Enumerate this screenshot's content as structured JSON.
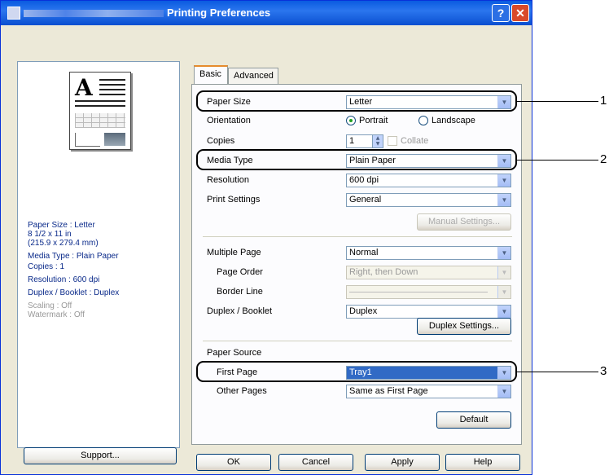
{
  "window": {
    "title": "Printing Preferences"
  },
  "tabs": [
    "Basic",
    "Advanced"
  ],
  "summary": {
    "paper_size": "Paper Size : Letter",
    "dimensions_in": "8 1/2 x 11 in",
    "dimensions_mm": "(215.9 x 279.4 mm)",
    "media_type": "Media Type : Plain Paper",
    "copies": "Copies : 1",
    "resolution": "Resolution : 600 dpi",
    "duplex": "Duplex / Booklet : Duplex",
    "scaling": "Scaling : Off",
    "watermark": "Watermark : Off"
  },
  "form": {
    "paper_size_label": "Paper Size",
    "paper_size_value": "Letter",
    "orientation_label": "Orientation",
    "portrait": "Portrait",
    "landscape": "Landscape",
    "copies_label": "Copies",
    "copies_value": "1",
    "collate": "Collate",
    "media_type_label": "Media Type",
    "media_type_value": "Plain Paper",
    "resolution_label": "Resolution",
    "resolution_value": "600 dpi",
    "print_settings_label": "Print Settings",
    "print_settings_value": "General",
    "manual_settings": "Manual Settings...",
    "multiple_page_label": "Multiple Page",
    "multiple_page_value": "Normal",
    "page_order_label": "Page Order",
    "page_order_value": "Right, then Down",
    "border_line_label": "Border Line",
    "duplex_label": "Duplex / Booklet",
    "duplex_value": "Duplex",
    "duplex_settings": "Duplex Settings...",
    "paper_source_label": "Paper Source",
    "first_page_label": "First Page",
    "first_page_value": "Tray1",
    "other_pages_label": "Other Pages",
    "other_pages_value": "Same as First Page",
    "default": "Default"
  },
  "buttons": {
    "support": "Support...",
    "ok": "OK",
    "cancel": "Cancel",
    "apply": "Apply",
    "help": "Help"
  },
  "callouts": [
    "1",
    "2",
    "3"
  ],
  "colors": {
    "titlebar": "#0a5be0",
    "selection": "#316ac5",
    "dialog_bg": "#ece9d8"
  }
}
